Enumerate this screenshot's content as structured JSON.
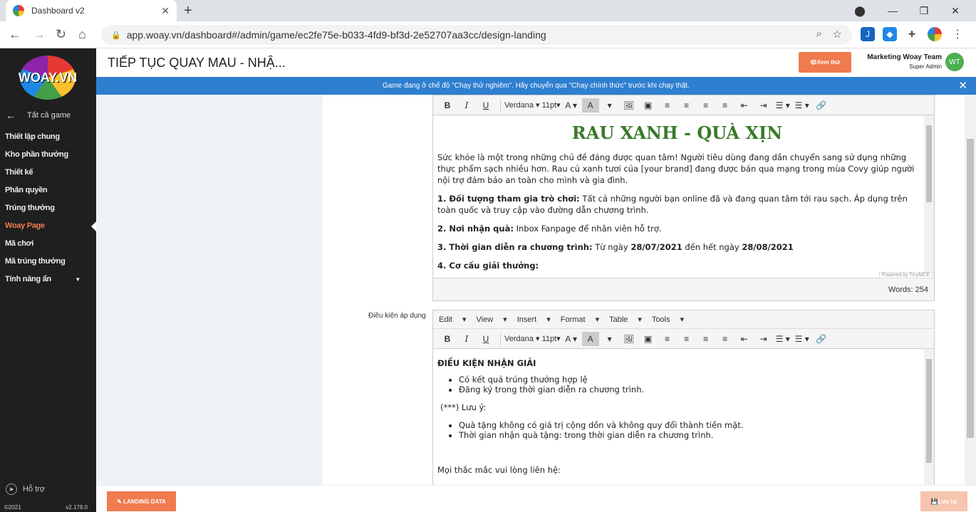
{
  "browser": {
    "tab_title": "Dashboard v2",
    "url": "app.woay.vn/dashboard#/admin/game/ec2fe75e-b033-4fd9-bf3d-2e52707aa3cc/design-landing"
  },
  "sidebar": {
    "logo_text": "WOAY.VN",
    "back_label": "Tất cả game",
    "items": [
      {
        "label": "Thiết lập chung"
      },
      {
        "label": "Kho phần thưởng"
      },
      {
        "label": "Thiết kế"
      },
      {
        "label": "Phân quyền"
      },
      {
        "label": "Trúng thưởng"
      },
      {
        "label": "Woay Page"
      },
      {
        "label": "Mã chơi"
      },
      {
        "label": "Mã trúng thưởng"
      },
      {
        "label": "Tính năng ẩn"
      }
    ],
    "active_index": 5,
    "help_label": "Hỗ trợ",
    "copyright": "©2021",
    "version": "v2.178.0"
  },
  "header": {
    "title": "TIẾP TỤC QUAY MAU - NHẬ...",
    "preview_label": "Xem thử",
    "user_name": "Marketing Woay Team",
    "user_role": "Super Admin",
    "avatar_initials": "WT"
  },
  "banner": {
    "text": "Game đang ở chế độ \"Chạy thử nghiệm\". Hãy chuyển qua \"Chạy chính thức\" trước khi chạy thật."
  },
  "toolbar": {
    "font": "Verdana",
    "size": "11pt"
  },
  "editor1": {
    "heading": "RAU XANH - QUÀ XỊN",
    "intro": "Sức khỏe là một trong những chủ đề đáng được quan tâm! Người tiêu dùng đang dần chuyển sang sử dụng những thực phẩm sạch nhiều hơn. Rau củ xanh tươi của [your brand] đang được bán qua mạng trong mùa Covy giúp người nội trợ đảm bảo an toàn cho mình và gia đình.",
    "s1_label": "1. Đối tượng tham gia trò chơi:",
    "s1_text": " Tất cả những người bạn online đã và đang quan tâm tới rau sạch. Áp dụng trên toàn quốc và truy cập vào đường dẫn chương trình.",
    "s2_label": "2. Nơi nhận quà:",
    "s2_text": " Inbox Fanpage để nhân viên hỗ trợ.",
    "s3_label": "3. Thời gian diễn ra chương trình:",
    "s3_text1": " Từ ngày ",
    "s3_date1": "28/07/2021",
    "s3_text2": " đến hết ngày ",
    "s3_date2": "28/08/2021",
    "s4_label": "4. Cơ cấu giải thưởng:",
    "powered": "Powered by TinyMCE",
    "words": "Words: 254"
  },
  "editor2": {
    "field_label": "Điều kiện áp dụng",
    "menu": [
      "Edit",
      "View",
      "Insert",
      "Format",
      "Table",
      "Tools"
    ],
    "heading": "ĐIỀU KIỆN NHẬN GIẢI",
    "list1": [
      "Có kết quả trúng thưởng hợp lệ",
      "Đăng ký trong thời gian diễn ra chương trình."
    ],
    "note": "(***) Lưu ý:",
    "list2": [
      "Quà tặng không có giá trị cộng dồn và không quy đổi thành tiền mặt.",
      "Thời gian nhận quà tặng: trong thời gian diễn ra chương trình."
    ],
    "contact": "Mọi thắc mắc vui lòng liên hệ:"
  },
  "footer": {
    "landing_label": "LANDING DATA",
    "save_label": "Lưu lại"
  }
}
